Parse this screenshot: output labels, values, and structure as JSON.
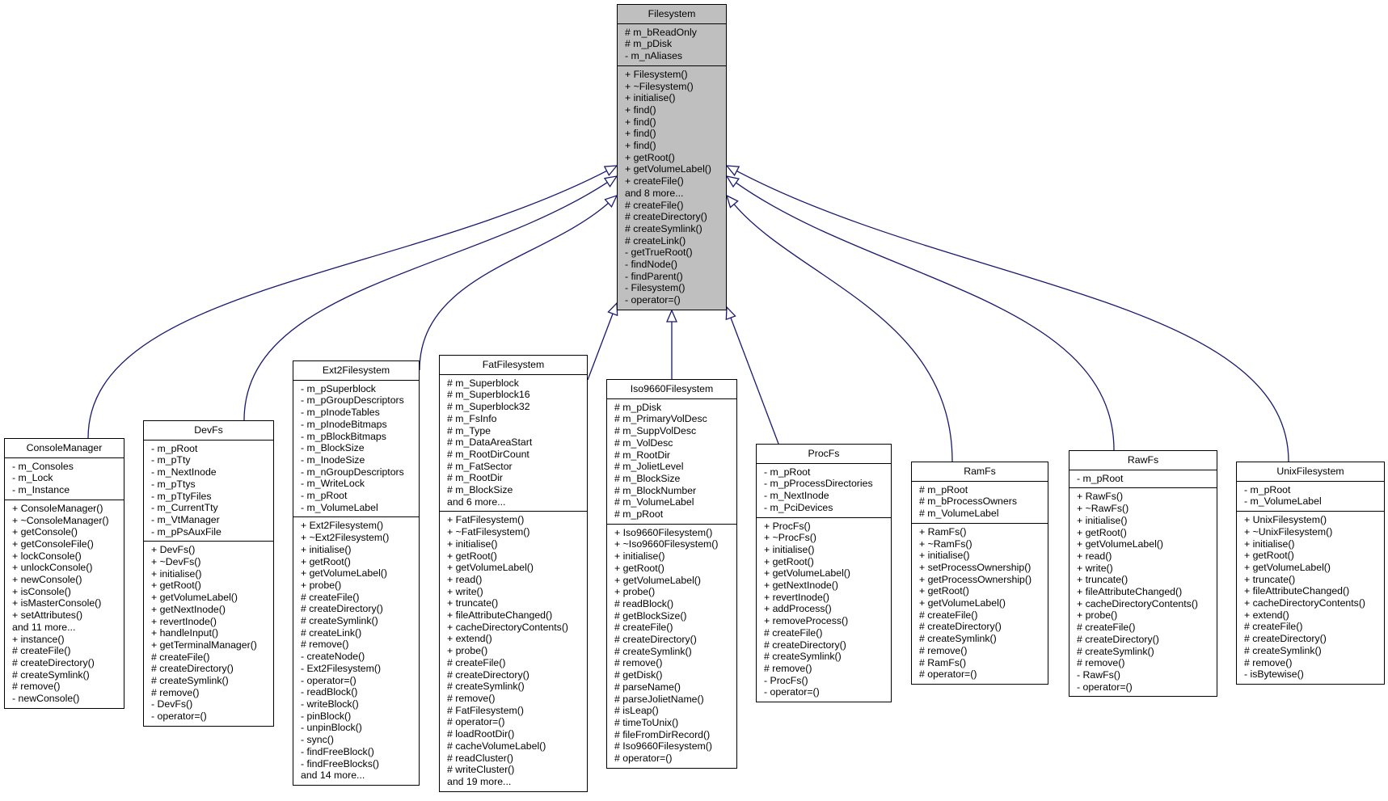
{
  "diagram": {
    "type": "class-inheritance",
    "edge_color": "#191970",
    "base_fill": "#bfbfbf",
    "base": {
      "id": "filesystem",
      "name": "Filesystem",
      "attributes": [
        "# m_bReadOnly",
        "# m_pDisk",
        "- m_nAliases"
      ],
      "methods": [
        "+ Filesystem()",
        "+ ~Filesystem()",
        "+ initialise()",
        "+ find()",
        "+ find()",
        "+ find()",
        "+ find()",
        "+ getRoot()",
        "+ getVolumeLabel()",
        "+ createFile()",
        "and 8 more...",
        "# createFile()",
        "# createDirectory()",
        "# createSymlink()",
        "# createLink()",
        "- getTrueRoot()",
        "- findNode()",
        "- findParent()",
        "- Filesystem()",
        "- operator=()"
      ]
    },
    "derived": [
      {
        "id": "consolemanager",
        "name": "ConsoleManager",
        "attributes": [
          "- m_Consoles",
          "- m_Lock",
          "- m_Instance"
        ],
        "methods": [
          "+ ConsoleManager()",
          "+ ~ConsoleManager()",
          "+ getConsole()",
          "+ getConsoleFile()",
          "+ lockConsole()",
          "+ unlockConsole()",
          "+ newConsole()",
          "+ isConsole()",
          "+ isMasterConsole()",
          "+ setAttributes()",
          "and 11 more...",
          "+ instance()",
          "# createFile()",
          "# createDirectory()",
          "# createSymlink()",
          "# remove()",
          "- newConsole()"
        ]
      },
      {
        "id": "devfs",
        "name": "DevFs",
        "attributes": [
          "- m_pRoot",
          "- m_pTty",
          "- m_NextInode",
          "- m_pTtys",
          "- m_pTtyFiles",
          "- m_CurrentTty",
          "- m_VtManager",
          "- m_pPsAuxFile"
        ],
        "methods": [
          "+ DevFs()",
          "+ ~DevFs()",
          "+ initialise()",
          "+ getRoot()",
          "+ getVolumeLabel()",
          "+ getNextInode()",
          "+ revertInode()",
          "+ handleInput()",
          "+ getTerminalManager()",
          "# createFile()",
          "# createDirectory()",
          "# createSymlink()",
          "# remove()",
          "- DevFs()",
          "- operator=()"
        ]
      },
      {
        "id": "ext2filesystem",
        "name": "Ext2Filesystem",
        "attributes": [
          "- m_pSuperblock",
          "- m_pGroupDescriptors",
          "- m_pInodeTables",
          "- m_pInodeBitmaps",
          "- m_pBlockBitmaps",
          "- m_BlockSize",
          "- m_InodeSize",
          "- m_nGroupDescriptors",
          "- m_WriteLock",
          "- m_pRoot",
          "- m_VolumeLabel"
        ],
        "methods": [
          "+ Ext2Filesystem()",
          "+ ~Ext2Filesystem()",
          "+ initialise()",
          "+ getRoot()",
          "+ getVolumeLabel()",
          "+ probe()",
          "# createFile()",
          "# createDirectory()",
          "# createSymlink()",
          "# createLink()",
          "# remove()",
          "- createNode()",
          "- Ext2Filesystem()",
          "- operator=()",
          "- readBlock()",
          "- writeBlock()",
          "- pinBlock()",
          "- unpinBlock()",
          "- sync()",
          "- findFreeBlock()",
          "- findFreeBlocks()",
          "and 14 more..."
        ]
      },
      {
        "id": "fatfilesystem",
        "name": "FatFilesystem",
        "attributes": [
          "# m_Superblock",
          "# m_Superblock16",
          "# m_Superblock32",
          "# m_FsInfo",
          "# m_Type",
          "# m_DataAreaStart",
          "# m_RootDirCount",
          "# m_FatSector",
          "# m_RootDir",
          "# m_BlockSize",
          "and 6 more..."
        ],
        "methods": [
          "+ FatFilesystem()",
          "+ ~FatFilesystem()",
          "+ initialise()",
          "+ getRoot()",
          "+ getVolumeLabel()",
          "+ read()",
          "+ write()",
          "+ truncate()",
          "+ fileAttributeChanged()",
          "+ cacheDirectoryContents()",
          "+ extend()",
          "+ probe()",
          "# createFile()",
          "# createDirectory()",
          "# createSymlink()",
          "# remove()",
          "# FatFilesystem()",
          "# operator=()",
          "# loadRootDir()",
          "# cacheVolumeLabel()",
          "# readCluster()",
          "# writeCluster()",
          "and 19 more..."
        ]
      },
      {
        "id": "iso9660filesystem",
        "name": "Iso9660Filesystem",
        "attributes": [
          "# m_pDisk",
          "# m_PrimaryVolDesc",
          "# m_SuppVolDesc",
          "# m_VolDesc",
          "# m_RootDir",
          "# m_JolietLevel",
          "# m_BlockSize",
          "# m_BlockNumber",
          "# m_VolumeLabel",
          "# m_pRoot"
        ],
        "methods": [
          "+ Iso9660Filesystem()",
          "+ ~Iso9660Filesystem()",
          "+ initialise()",
          "+ getRoot()",
          "+ getVolumeLabel()",
          "+ probe()",
          "# readBlock()",
          "# getBlockSize()",
          "# createFile()",
          "# createDirectory()",
          "# createSymlink()",
          "# remove()",
          "# getDisk()",
          "# parseName()",
          "# parseJolietName()",
          "# isLeap()",
          "# timeToUnix()",
          "# fileFromDirRecord()",
          "# Iso9660Filesystem()",
          "# operator=()"
        ]
      },
      {
        "id": "procfs",
        "name": "ProcFs",
        "attributes": [
          "- m_pRoot",
          "- m_pProcessDirectories",
          "- m_NextInode",
          "- m_PciDevices"
        ],
        "methods": [
          "+ ProcFs()",
          "+ ~ProcFs()",
          "+ initialise()",
          "+ getRoot()",
          "+ getVolumeLabel()",
          "+ getNextInode()",
          "+ revertInode()",
          "+ addProcess()",
          "+ removeProcess()",
          "# createFile()",
          "# createDirectory()",
          "# createSymlink()",
          "# remove()",
          "- ProcFs()",
          "- operator=()"
        ]
      },
      {
        "id": "ramfs",
        "name": "RamFs",
        "attributes": [
          "# m_pRoot",
          "# m_bProcessOwners",
          "# m_VolumeLabel"
        ],
        "methods": [
          "+ RamFs()",
          "+ ~RamFs()",
          "+ initialise()",
          "+ setProcessOwnership()",
          "+ getProcessOwnership()",
          "+ getRoot()",
          "+ getVolumeLabel()",
          "# createFile()",
          "# createDirectory()",
          "# createSymlink()",
          "# remove()",
          "# RamFs()",
          "# operator=()"
        ]
      },
      {
        "id": "rawfs",
        "name": "RawFs",
        "attributes": [
          "- m_pRoot"
        ],
        "methods": [
          "+ RawFs()",
          "+ ~RawFs()",
          "+ initialise()",
          "+ getRoot()",
          "+ getVolumeLabel()",
          "+ read()",
          "+ write()",
          "+ truncate()",
          "+ fileAttributeChanged()",
          "+ cacheDirectoryContents()",
          "+ probe()",
          "# createFile()",
          "# createDirectory()",
          "# createSymlink()",
          "# remove()",
          "- RawFs()",
          "- operator=()"
        ]
      },
      {
        "id": "unixfilesystem",
        "name": "UnixFilesystem",
        "attributes": [
          "- m_pRoot",
          "- m_VolumeLabel"
        ],
        "methods": [
          "+ UnixFilesystem()",
          "+ ~UnixFilesystem()",
          "+ initialise()",
          "+ getRoot()",
          "+ getVolumeLabel()",
          "+ truncate()",
          "+ fileAttributeChanged()",
          "+ cacheDirectoryContents()",
          "+ extend()",
          "# createFile()",
          "# createDirectory()",
          "# createSymlink()",
          "# remove()",
          "- isBytewise()"
        ]
      }
    ],
    "edges": [
      {
        "from": "consolemanager",
        "to": "filesystem"
      },
      {
        "from": "devfs",
        "to": "filesystem"
      },
      {
        "from": "ext2filesystem",
        "to": "filesystem"
      },
      {
        "from": "fatfilesystem",
        "to": "filesystem"
      },
      {
        "from": "iso9660filesystem",
        "to": "filesystem"
      },
      {
        "from": "procfs",
        "to": "filesystem"
      },
      {
        "from": "ramfs",
        "to": "filesystem"
      },
      {
        "from": "rawfs",
        "to": "filesystem"
      },
      {
        "from": "unixfilesystem",
        "to": "filesystem"
      }
    ]
  }
}
